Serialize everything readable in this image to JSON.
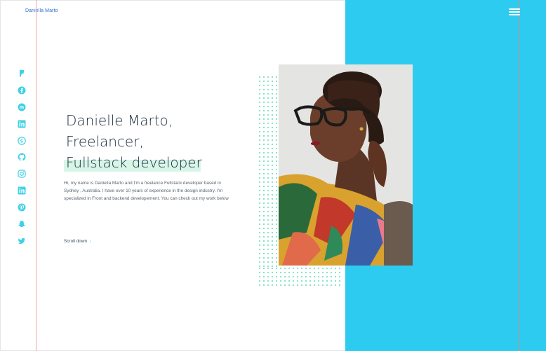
{
  "brand": {
    "name": "Daniella Marto"
  },
  "header": {
    "menu_icon": "hamburger-menu-icon"
  },
  "social": [
    {
      "icon": "foursquare-icon"
    },
    {
      "icon": "facebook-icon"
    },
    {
      "icon": "meetup-icon"
    },
    {
      "icon": "linkedin-icon"
    },
    {
      "icon": "skype-icon"
    },
    {
      "icon": "github-icon"
    },
    {
      "icon": "instagram-icon"
    },
    {
      "icon": "linkedin-alt-icon"
    },
    {
      "icon": "pinterest-icon"
    },
    {
      "icon": "snapchat-icon"
    },
    {
      "icon": "twitter-icon"
    }
  ],
  "hero": {
    "line1": "Danielle Marto,",
    "line2": "Freelancer,",
    "line3": "Fullstack developer",
    "intro": "Hi, my name is Daniella Marto and I'm a freelance Fullstack developer based in Sydney , Australia. I have over 10 years of experience in the design industry. I'm specialized in Front and  backend developement. You can check out my work below",
    "scroll_label": "Scroll down",
    "scroll_arrow": "↓"
  },
  "colors": {
    "accent_blue": "#2ecbf1",
    "highlight_green": "#d7f6e8",
    "dot_green": "#7fe4c7",
    "brand_blue": "#2a6fd1"
  }
}
